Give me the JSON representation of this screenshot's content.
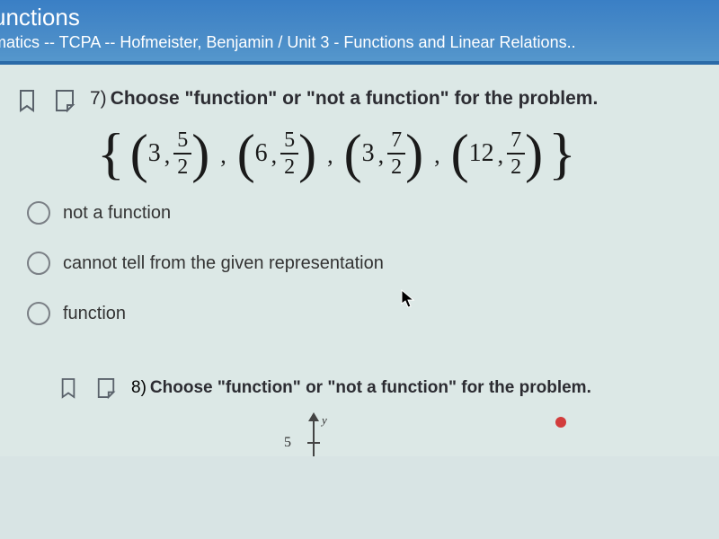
{
  "header": {
    "title_fragment": "unctions",
    "breadcrumb": "matics -- TCPA -- Hofmeister, Benjamin / Unit 3 - Functions and Linear Relations.."
  },
  "q7": {
    "number": "7)",
    "prompt": "Choose \"function\" or \"not a function\" for the problem.",
    "set": {
      "p1": {
        "a": "3",
        "num": "5",
        "den": "2"
      },
      "p2": {
        "a": "6",
        "num": "5",
        "den": "2"
      },
      "p3": {
        "a": "3",
        "num": "7",
        "den": "2"
      },
      "p4": {
        "a": "12",
        "num": "7",
        "den": "2"
      }
    },
    "options": {
      "o1": "not a function",
      "o2": "cannot tell from the given representation",
      "o3": "function"
    }
  },
  "q8": {
    "number": "8)",
    "prompt": "Choose \"function\" or \"not a function\" for the problem.",
    "tick": "5",
    "ylabel": "y"
  }
}
